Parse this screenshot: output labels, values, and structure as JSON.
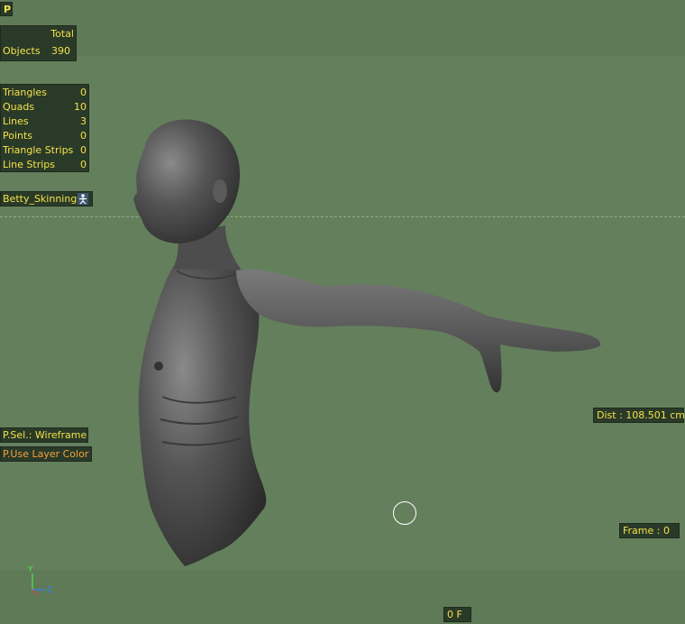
{
  "hud": {
    "p_button": "P",
    "objects": {
      "header": "Total",
      "label": "Objects",
      "value": "390"
    },
    "stats": [
      {
        "label": "Triangles",
        "value": "0"
      },
      {
        "label": "Quads",
        "value": "10"
      },
      {
        "label": "Lines",
        "value": "3"
      },
      {
        "label": "Points",
        "value": "0"
      },
      {
        "label": "Triangle Strips",
        "value": "0"
      },
      {
        "label": "Line Strips",
        "value": "0"
      }
    ],
    "layer_name": "Betty_Skinning",
    "psel": "P.Sel.: Wireframe",
    "puse_layer_color": "P.Use Layer Color",
    "distance": "Dist : 108.501 cm",
    "frame": "Frame : 0",
    "frame_counter": "0 F"
  },
  "gizmo": {
    "y_axis": "Y",
    "z_axis": "Z"
  },
  "colors": {
    "viewport_bg": "#647f5c",
    "band": "#5e7a57",
    "hud_text": "#f3e24a",
    "hud_orange": "#f4a23a",
    "hud_bg": "#2a3a28",
    "model": "#4a4a4a"
  }
}
